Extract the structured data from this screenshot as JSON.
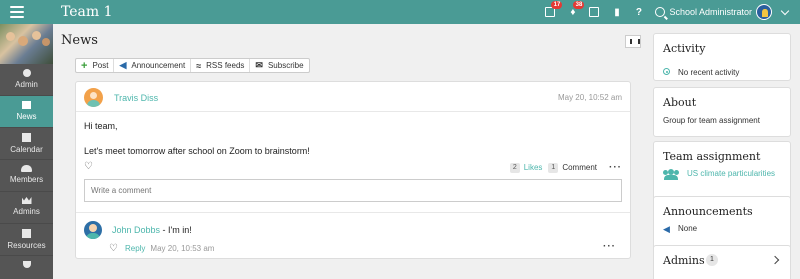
{
  "topbar": {
    "title": "Team 1",
    "badges": {
      "tasks": "17",
      "notifications": "38"
    },
    "user_name": "School Administrator"
  },
  "sidebar": {
    "items": [
      {
        "label": "Admin",
        "icon": "gear-icon"
      },
      {
        "label": "News",
        "icon": "news-icon",
        "active": true
      },
      {
        "label": "Calendar",
        "icon": "calendar-icon"
      },
      {
        "label": "Members",
        "icon": "members-icon"
      },
      {
        "label": "Admins",
        "icon": "crown-icon"
      },
      {
        "label": "Resources",
        "icon": "resources-icon"
      }
    ]
  },
  "main": {
    "title": "News",
    "toolbar": {
      "post": "Post",
      "announcement": "Announcement",
      "rss": "RSS feeds",
      "subscribe": "Subscribe"
    },
    "post": {
      "author": "Travis Diss",
      "date": "May 20, 10:52 am",
      "body": [
        "Hi team,",
        "Let's meet tomorrow after school on Zoom to brainstorm!"
      ],
      "likes_count": "2",
      "likes_label": "Likes",
      "comments_count": "1",
      "comment_label": "Comment",
      "comment_placeholder": "Write a comment"
    },
    "comment": {
      "author": "John Dobbs",
      "text": " - I'm in!",
      "reply_label": "Reply",
      "date": "May 20, 10:53 am"
    }
  },
  "right": {
    "activity": {
      "title": "Activity",
      "text": "No recent activity"
    },
    "about": {
      "title": "About",
      "text": "Group for team assignment"
    },
    "team_assignment": {
      "title": "Team assignment",
      "link": "US climate particularities"
    },
    "announcements": {
      "title": "Announcements",
      "text": "None"
    },
    "admins": {
      "title": "Admins",
      "count": "1"
    }
  },
  "colors": {
    "accent": "#4a9b95",
    "link": "#4db6ac",
    "sidebar": "#555555",
    "badge": "#e53935"
  }
}
